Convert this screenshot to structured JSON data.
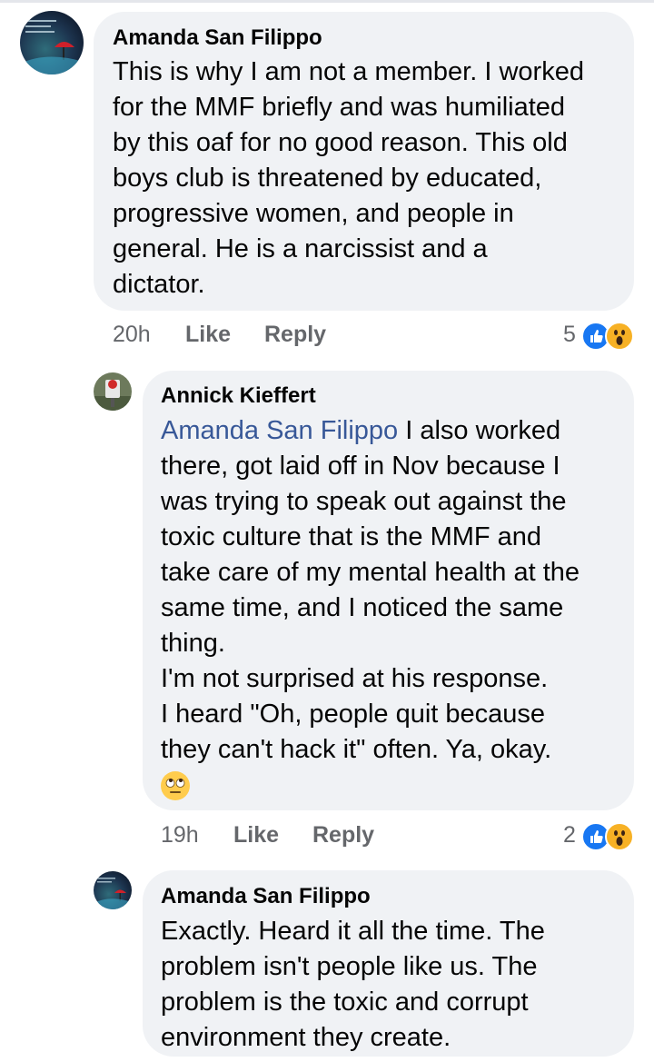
{
  "comments": [
    {
      "author": "Amanda San Filippo",
      "lines": [
        "This is why I am not a member. I worked",
        "for the MMF briefly and was humiliated",
        "by this oaf for no good reason. This old",
        "boys club is threatened by educated,",
        "progressive women, and people in",
        "general. He is a narcissist and a",
        "dictator."
      ],
      "time": "20h",
      "like_label": "Like",
      "reply_label": "Reply",
      "reaction_count": "5"
    },
    {
      "author": "Annick Kieffert",
      "mention": "Amanda San Filippo",
      "lines": [
        " I also worked",
        "there, got laid off in Nov because I",
        "was trying to speak out against the",
        "toxic culture that is the MMF and",
        "take care of my mental health at the",
        "same time, and I noticed the same",
        "thing.",
        "I'm not surprised at his response.",
        "I heard \"Oh, people quit because",
        "they can't hack it\"  often. Ya, okay."
      ],
      "emoji": "face-with-rolling-eyes",
      "time": "19h",
      "like_label": "Like",
      "reply_label": "Reply",
      "reaction_count": "2"
    },
    {
      "author": "Amanda San Filippo",
      "lines": [
        "Exactly. Heard it all the time. The",
        "problem isn't people like us. The",
        "problem is the toxic and corrupt",
        "environment they create."
      ]
    }
  ],
  "icons": {
    "like": "like-reaction-icon",
    "wow": "wow-reaction-icon",
    "like_color": "#1877f2",
    "wow_color": "#f7b125",
    "mention_color": "#385898",
    "bubble_color": "#f0f2f5"
  }
}
